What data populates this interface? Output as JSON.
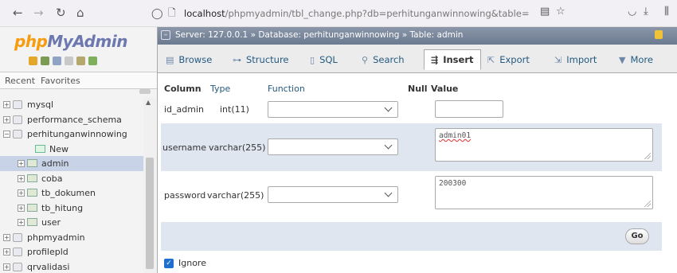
{
  "browser": {
    "url_host": "localhost",
    "url_path": "/phpmyadmin/tbl_change.php?db=perhitunganwinnowing&table="
  },
  "nav": {
    "logo_php": "php",
    "logo_myadmin": "MyAdmin",
    "recent_tab": "Recent",
    "favorites_tab": "Favorites",
    "tree": [
      {
        "label": "mysql",
        "level": 0,
        "type": "db"
      },
      {
        "label": "performance_schema",
        "level": 0,
        "type": "db"
      },
      {
        "label": "perhitunganwinnowing",
        "level": 0,
        "type": "db"
      },
      {
        "label": "New",
        "level": 1,
        "type": "new"
      },
      {
        "label": "admin",
        "level": 1,
        "type": "table",
        "selected": true
      },
      {
        "label": "coba",
        "level": 1,
        "type": "table"
      },
      {
        "label": "tb_dokumen",
        "level": 1,
        "type": "table"
      },
      {
        "label": "tb_hitung",
        "level": 1,
        "type": "table"
      },
      {
        "label": "user",
        "level": 1,
        "type": "table"
      },
      {
        "label": "phpmyadmin",
        "level": 0,
        "type": "db"
      },
      {
        "label": "profilepld",
        "level": 0,
        "type": "db"
      },
      {
        "label": "qrvalidasi",
        "level": 0,
        "type": "db"
      }
    ]
  },
  "breadcrumb": {
    "server": "Server: 127.0.0.1",
    "database": "Database: perhitunganwinnowing",
    "table": "Table: admin"
  },
  "tabs": [
    {
      "label": "Browse",
      "icon": "browse-icon"
    },
    {
      "label": "Structure",
      "icon": "structure-icon"
    },
    {
      "label": "SQL",
      "icon": "sql-icon"
    },
    {
      "label": "Search",
      "icon": "search-icon"
    },
    {
      "label": "Insert",
      "icon": "insert-icon",
      "active": true
    },
    {
      "label": "Export",
      "icon": "export-icon"
    },
    {
      "label": "Import",
      "icon": "import-icon"
    },
    {
      "label": "More",
      "icon": "more-icon"
    }
  ],
  "insert_table": {
    "headers": {
      "column": "Column",
      "type": "Type",
      "function": "Function",
      "null": "Null",
      "value": "Value"
    },
    "rows": [
      {
        "column": "id_admin",
        "type": "int(11)",
        "function": "",
        "value": ""
      },
      {
        "column": "username",
        "type": "varchar(255)",
        "function": "",
        "value": "admin01"
      },
      {
        "column": "password",
        "type": "varchar(255)",
        "function": "",
        "value": "200300"
      }
    ],
    "go_label": "Go",
    "ignore_label": "Ignore"
  },
  "colors": {
    "accent": "#235a81",
    "row_highlight": "#dfe6f0",
    "logo_blue": "#6c78af",
    "logo_orange": "#f89c0e"
  }
}
